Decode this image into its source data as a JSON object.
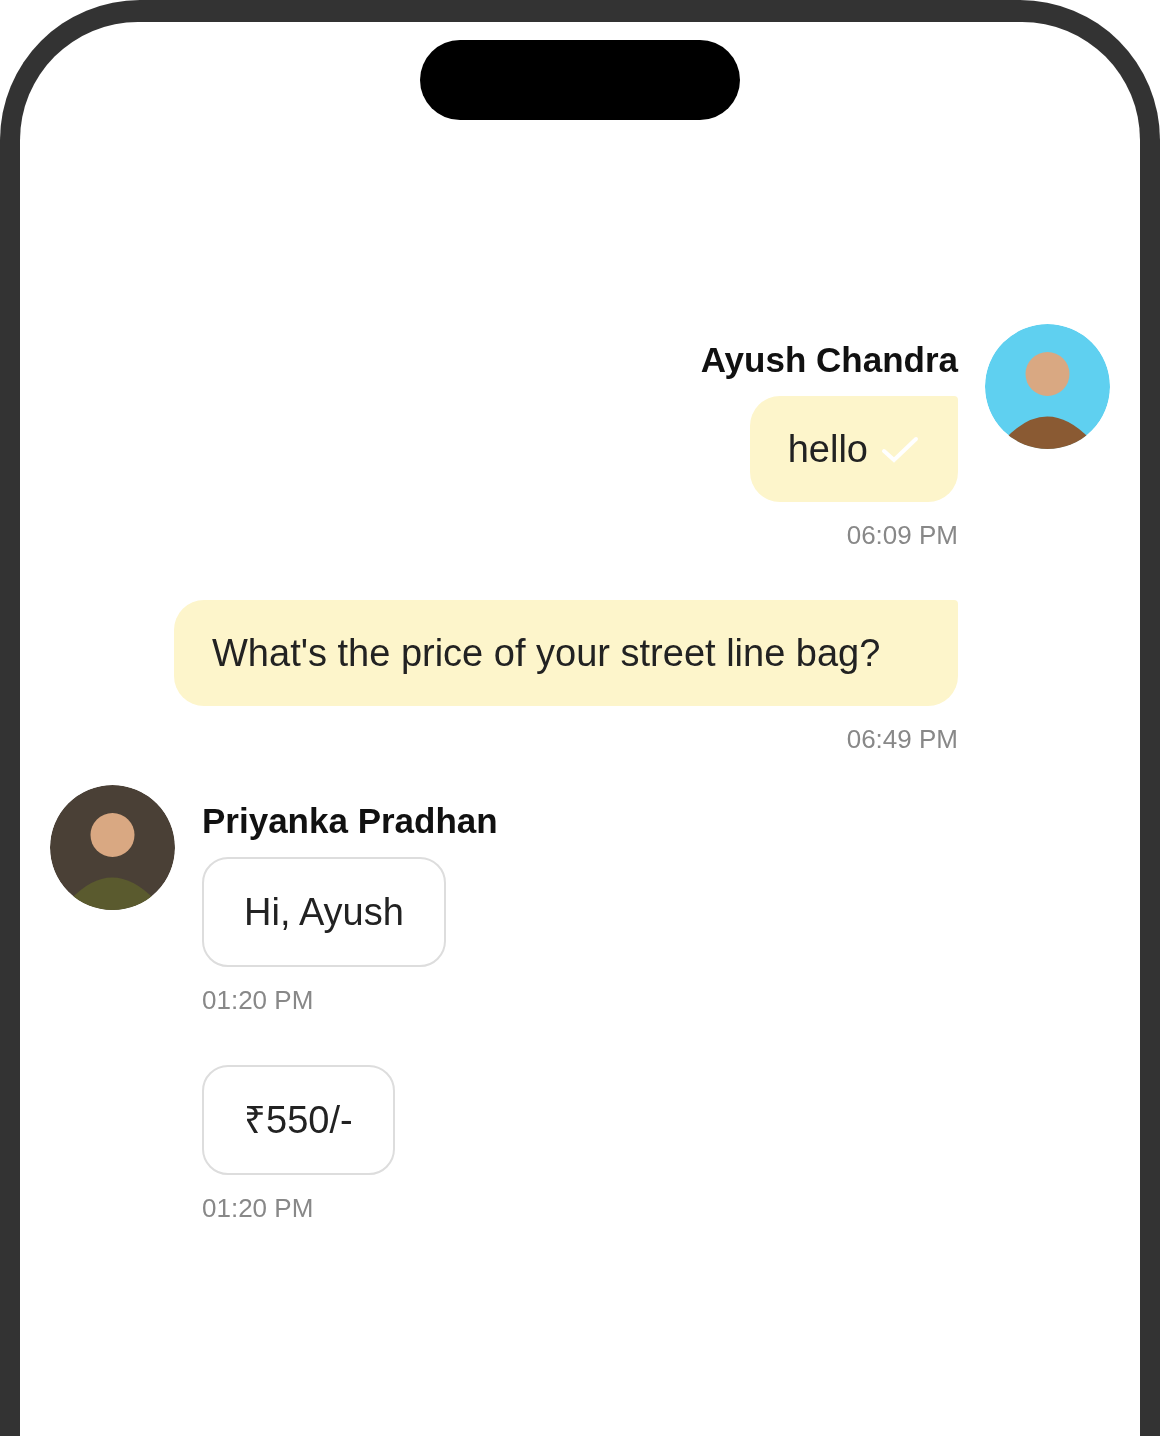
{
  "groups": [
    {
      "kind": "sent",
      "sender": "Ayush Chandra",
      "messages": [
        {
          "text": "hello",
          "ticked": true,
          "time": "06:09 PM"
        },
        {
          "text": "What's the price of your street line bag?",
          "ticked": false,
          "time": "06:49 PM"
        }
      ]
    },
    {
      "kind": "received",
      "sender": "Priyanka Pradhan",
      "messages": [
        {
          "text": "Hi, Ayush",
          "ticked": false,
          "time": "01:20 PM"
        },
        {
          "text": "₹550/-",
          "ticked": false,
          "time": "01:20 PM"
        }
      ]
    }
  ]
}
